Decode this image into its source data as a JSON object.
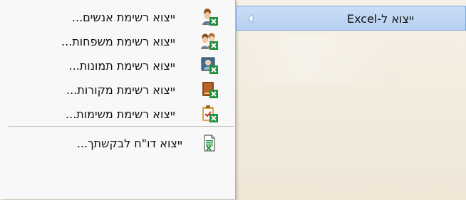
{
  "parent_menu": {
    "selected_label": "ייצוא ל-Excel"
  },
  "submenu": {
    "items": [
      {
        "label": "ייצוא רשימת אנשים...",
        "icon": "people-excel-icon"
      },
      {
        "label": "ייצוא רשימת משפחות...",
        "icon": "family-excel-icon"
      },
      {
        "label": "ייצוא רשימת תמונות...",
        "icon": "photo-excel-icon"
      },
      {
        "label": "ייצוא רשימת מקורות...",
        "icon": "book-excel-icon"
      },
      {
        "label": "ייצוא רשימת משימות...",
        "icon": "tasks-excel-icon"
      },
      {
        "label": "ייצוא דו\"ח לבקשתך...",
        "icon": "report-excel-icon"
      }
    ]
  }
}
